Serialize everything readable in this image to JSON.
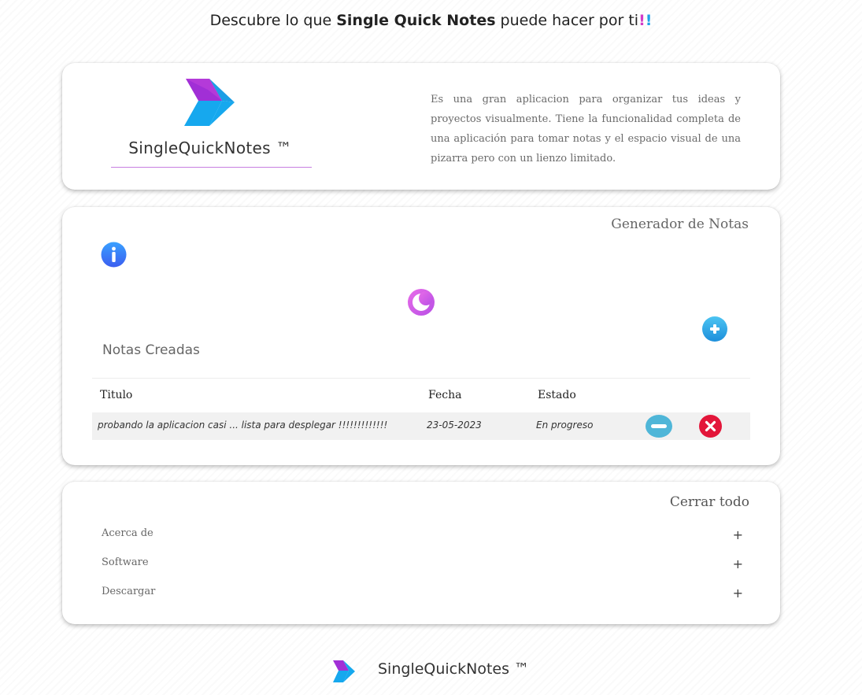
{
  "headline": {
    "prefix": "Descubre lo que ",
    "brand": "Single Quick Notes",
    "suffix": " puede hacer por ti",
    "bang1": "!",
    "bang2": "!"
  },
  "intro": {
    "logo_text": "SingleQuickNotes ™",
    "description": "Es una gran aplicacion para organizar tus ideas y proyectos visualmente. Tiene la funcionalidad completa de una aplicación para tomar notas y el espacio visual de una pizarra pero con un lienzo limitado."
  },
  "generator": {
    "title": "Generador de Notas",
    "notes_title": "Notas Creadas",
    "columns": [
      "Titulo",
      "Fecha",
      "Estado"
    ],
    "rows": [
      {
        "title": "probando la aplicacion casi ... lista para desplegar !!!!!!!!!!!!!",
        "date": "23-05-2023",
        "status": "En progreso"
      }
    ],
    "icons": {
      "info": "info-icon",
      "theme": "moon-icon",
      "add": "plus-icon",
      "edit": "minus-icon",
      "delete": "close-icon"
    }
  },
  "accordion": {
    "close_all": "Cerrar todo",
    "items": [
      {
        "label": "Acerca de",
        "toggle": "+"
      },
      {
        "label": "Software",
        "toggle": "+"
      },
      {
        "label": "Descargar",
        "toggle": "+"
      }
    ]
  },
  "footer": {
    "brand": "SingleQuickNotes ™"
  },
  "colors": {
    "brand_purple": "#a12fd6",
    "brand_blue": "#16a8ee",
    "delete_red": "#e3163a",
    "edit_blue": "#4fb6d8"
  }
}
